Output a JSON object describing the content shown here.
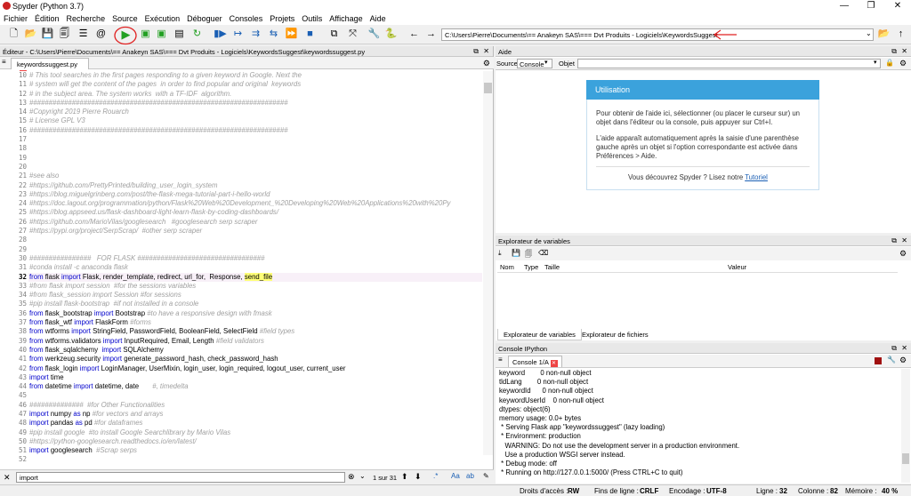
{
  "window": {
    "title": "Spyder (Python 3.7)"
  },
  "menu": [
    "Fichier",
    "Édition",
    "Recherche",
    "Source",
    "Exécution",
    "Déboguer",
    "Consoles",
    "Projets",
    "Outils",
    "Affichage",
    "Aide"
  ],
  "toolbar": {
    "path": "C:\\Users\\Pierre\\Documents\\== Anakeyn SAS\\=== Dvt Produits - Logiciels\\KeywordsSuggest"
  },
  "editor": {
    "header": "Éditeur - C:\\Users\\Pierre\\Documents\\== Anakeyn SAS\\=== Dvt Produits - Logiciels\\KeywordsSuggest\\keywordssuggest.py",
    "tab": "keywordssuggest.py",
    "lines": [
      {
        "n": "10",
        "t": "# This tool searches in the first pages responding to a given keyword in Google. Next the",
        "c": "cm"
      },
      {
        "n": "11",
        "t": "# system will get the content of the pages  in order to find popular and original  keywords",
        "c": "cm"
      },
      {
        "n": "12",
        "t": "# in the subject area. The system works  with a TF-IDF  algorithm.",
        "c": "cm"
      },
      {
        "n": "13",
        "t": "###################################################################",
        "c": "cm"
      },
      {
        "n": "14",
        "t": "#Copyright 2019 Pierre Rouarch",
        "c": "cm"
      },
      {
        "n": "15",
        "t": "# License GPL V3",
        "c": "cm"
      },
      {
        "n": "16",
        "t": "###################################################################",
        "c": "cm"
      },
      {
        "n": "17",
        "t": "",
        "c": "cm"
      },
      {
        "n": "18",
        "t": "",
        "c": "cm"
      },
      {
        "n": "19",
        "t": "",
        "c": "cm"
      },
      {
        "n": "20",
        "t": "",
        "c": "cm"
      },
      {
        "n": "21",
        "t": "#see also",
        "c": "cm"
      },
      {
        "n": "22",
        "t": "#https://github.com/PrettyPrinted/building_user_login_system",
        "c": "cm"
      },
      {
        "n": "23",
        "t": "#https://blog.miguelgrinberg.com/post/the-flask-mega-tutorial-part-i-hello-world",
        "c": "cm"
      },
      {
        "n": "24",
        "t": "#https://doc.lagout.org/programmation/python/Flask%20Web%20Development_%20Developing%20Web%20Applications%20with%20Py",
        "c": "cm"
      },
      {
        "n": "25",
        "t": "#https://blog.appseed.us/flask-dashboard-light-learn-flask-by-coding-dashboards/",
        "c": "cm"
      },
      {
        "n": "26",
        "t": "#https://github.com/MarioVilas/googlesearch   #googlesearch serp scraper",
        "c": "cm"
      },
      {
        "n": "27",
        "t": "#https://pypi.org/project/SerpScrap/  #other serp scraper",
        "c": "cm"
      },
      {
        "n": "28",
        "t": "",
        "c": "cm"
      },
      {
        "n": "29",
        "t": "",
        "c": "cm"
      },
      {
        "n": "30",
        "t": "################   FOR FLASK #################################",
        "c": "cm"
      },
      {
        "n": "31",
        "t": "#conda install -c anaconda flask",
        "c": "cm"
      },
      {
        "n": "32",
        "t": "",
        "c": "code",
        "parts": [
          [
            "kw",
            "from "
          ],
          [
            "id",
            "flask "
          ],
          [
            "kw",
            "import "
          ],
          [
            "id",
            "Flask, render_template, redirect, url_for,  Response, "
          ],
          [
            "hl",
            "send_file"
          ]
        ],
        "cur": true
      },
      {
        "n": "33",
        "t": "#from flask import session  #for the sessions variables",
        "c": "cm"
      },
      {
        "n": "34",
        "t": "#from flask_session import Session #for sessions",
        "c": "cm"
      },
      {
        "n": "35",
        "t": "#pip install flask-bootstrap  #if not installed in a console",
        "c": "cm"
      },
      {
        "n": "36",
        "t": "",
        "c": "code",
        "parts": [
          [
            "kw",
            "from "
          ],
          [
            "id",
            "flask_bootstrap "
          ],
          [
            "kw",
            "import "
          ],
          [
            "id",
            "Bootstrap "
          ],
          [
            "cm",
            "#to have a responsive design with fmask"
          ]
        ]
      },
      {
        "n": "37",
        "t": "",
        "c": "code",
        "parts": [
          [
            "kw",
            "from "
          ],
          [
            "id",
            "flask_wtf "
          ],
          [
            "kw",
            "import "
          ],
          [
            "id",
            "FlaskForm "
          ],
          [
            "cm",
            "#forms"
          ]
        ]
      },
      {
        "n": "38",
        "t": "",
        "c": "code",
        "parts": [
          [
            "kw",
            "from "
          ],
          [
            "id",
            "wtforms "
          ],
          [
            "kw",
            "import "
          ],
          [
            "id",
            "StringField, PasswordField, BooleanField, SelectField "
          ],
          [
            "cm",
            "#field types"
          ]
        ]
      },
      {
        "n": "39",
        "t": "",
        "c": "code",
        "parts": [
          [
            "kw",
            "from "
          ],
          [
            "id",
            "wtforms.validators "
          ],
          [
            "kw",
            "import "
          ],
          [
            "id",
            "InputRequired, Email, Length "
          ],
          [
            "cm",
            "#field validators"
          ]
        ]
      },
      {
        "n": "40",
        "t": "",
        "c": "code",
        "parts": [
          [
            "kw",
            "from "
          ],
          [
            "id",
            "flask_sqlalchemy  "
          ],
          [
            "kw",
            "import "
          ],
          [
            "id",
            "SQLAlchemy"
          ]
        ]
      },
      {
        "n": "41",
        "t": "",
        "c": "code",
        "parts": [
          [
            "kw",
            "from "
          ],
          [
            "id",
            "werkzeug.security "
          ],
          [
            "kw",
            "import "
          ],
          [
            "id",
            "generate_password_hash, check_password_hash"
          ]
        ]
      },
      {
        "n": "42",
        "t": "",
        "c": "code",
        "parts": [
          [
            "kw",
            "from "
          ],
          [
            "id",
            "flask_login "
          ],
          [
            "kw",
            "import "
          ],
          [
            "id",
            "LoginManager, UserMixin, login_user, login_required, logout_user, current_user"
          ]
        ]
      },
      {
        "n": "43",
        "t": "",
        "c": "code",
        "parts": [
          [
            "kw",
            "import "
          ],
          [
            "id",
            "time"
          ]
        ]
      },
      {
        "n": "44",
        "t": "",
        "c": "code",
        "parts": [
          [
            "kw",
            "from "
          ],
          [
            "id",
            "datetime "
          ],
          [
            "kw",
            "import "
          ],
          [
            "id",
            "datetime, date       "
          ],
          [
            "cm",
            "#, timedelta"
          ]
        ]
      },
      {
        "n": "45",
        "t": "",
        "c": "cm"
      },
      {
        "n": "46",
        "t": "##############  #for Other Functionalities",
        "c": "cm"
      },
      {
        "n": "47",
        "t": "",
        "c": "code",
        "parts": [
          [
            "kw",
            "import "
          ],
          [
            "id",
            "numpy "
          ],
          [
            "kw",
            "as "
          ],
          [
            "id",
            "np "
          ],
          [
            "cm",
            "#for vectors and arrays"
          ]
        ]
      },
      {
        "n": "48",
        "t": "",
        "c": "code",
        "parts": [
          [
            "kw",
            "import "
          ],
          [
            "id",
            "pandas "
          ],
          [
            "kw",
            "as "
          ],
          [
            "id",
            "pd "
          ],
          [
            "cm",
            "#for dataframes"
          ]
        ]
      },
      {
        "n": "49",
        "t": "#pip install google  #to install Google Searchlibrary by Mario Vilas",
        "c": "cm"
      },
      {
        "n": "50",
        "t": "#https://python-googlesearch.readthedocs.io/en/latest/",
        "c": "cm"
      },
      {
        "n": "51",
        "t": "",
        "c": "code",
        "parts": [
          [
            "kw",
            "import "
          ],
          [
            "id",
            "googlesearch  "
          ],
          [
            "cm",
            "#Scrap serps"
          ]
        ]
      },
      {
        "n": "52",
        "t": "#to randomize pause",
        "c": "cm"
      }
    ]
  },
  "find": {
    "value": "import",
    "count": "1 sur 31"
  },
  "help": {
    "header": "Aide",
    "source_label": "Source",
    "source_value": "Console",
    "object_label": "Objet",
    "card_title": "Utilisation",
    "p1": "Pour obtenir de l'aide ici, sélectionner (ou placer le curseur sur) un objet dans l'éditeur ou la console, puis appuyer sur Ctrl+I.",
    "p2": "L'aide apparaît automatiquement après la saisie d'une parenthèse gauche après un objet si l'option correspondante est activée dans Préférences > Aide.",
    "p3": "Vous découvrez Spyder ? Lisez notre",
    "link": "Tutoriel"
  },
  "varexp": {
    "header": "Explorateur de variables",
    "cols": [
      "Nom",
      "Type",
      "Taille",
      "Valeur"
    ],
    "tabs": [
      "Explorateur de variables",
      "Explorateur de fichiers"
    ]
  },
  "console": {
    "header": "Console IPython",
    "tab": "Console 1/A",
    "lines": [
      "keyword        0 non-null object",
      "tldLang        0 non-null object",
      "keywordId      0 non-null object",
      "keywordUserId    0 non-null object",
      "dtypes: object(6)",
      "memory usage: 0.0+ bytes",
      " * Serving Flask app \"keywordssuggest\" (lazy loading)",
      " * Environment: production",
      "   WARNING: Do not use the development server in a production environment.",
      "   Use a production WSGI server instead.",
      " * Debug mode: off",
      " * Running on http://127.0.0.1:5000/ (Press CTRL+C to quit)"
    ]
  },
  "status": {
    "access_label": "Droits d'accès :",
    "access": "RW",
    "eol_label": "Fins de ligne :",
    "eol": "CRLF",
    "enc_label": "Encodage :",
    "enc": "UTF-8",
    "line_label": "Ligne :",
    "line": "32",
    "col_label": "Colonne :",
    "col": "82",
    "mem_label": "Mémoire :",
    "mem": "40 %"
  },
  "colors": {
    "accent": "#3ba2dc",
    "annotation_red": "#e02020",
    "run_green": "#22a022"
  }
}
